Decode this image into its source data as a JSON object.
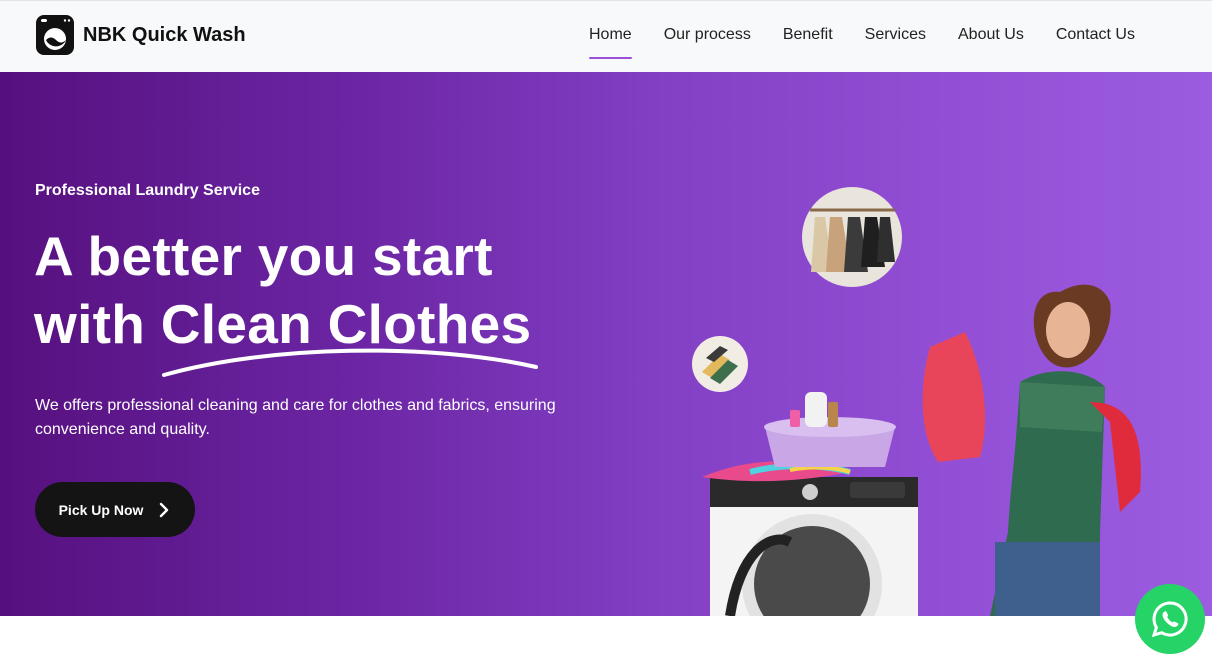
{
  "header": {
    "brand_name": "NBK Quick Wash",
    "logo_icon": "washing-machine-icon",
    "nav": [
      {
        "label": "Home",
        "active": true
      },
      {
        "label": "Our process",
        "active": false
      },
      {
        "label": "Benefit",
        "active": false
      },
      {
        "label": "Services",
        "active": false
      },
      {
        "label": "About Us",
        "active": false
      },
      {
        "label": "Contact Us",
        "active": false
      }
    ]
  },
  "hero": {
    "eyebrow": "Professional Laundry Service",
    "headline_line1": "A better you start",
    "headline_line2_prefix": "with ",
    "headline_highlight": "Clean Clothes",
    "lead": "We offers professional cleaning and care for clothes and fabrics, ensuring convenience and quality.",
    "cta_label": "Pick Up Now",
    "cta_icon": "chevron-right-icon"
  },
  "floating": {
    "whatsapp_icon": "whatsapp-icon"
  },
  "colors": {
    "accent": "#9b4fd8",
    "hero_start": "#56107e",
    "hero_end": "#9b5ce0",
    "cta_bg": "#141414",
    "whatsapp": "#25d366"
  }
}
